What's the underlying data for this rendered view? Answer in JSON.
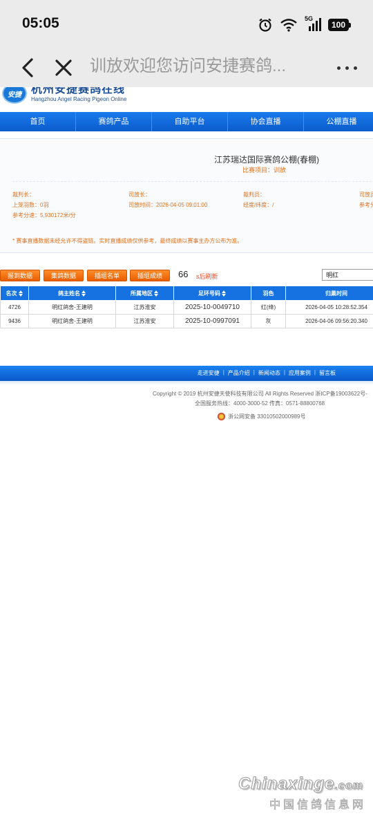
{
  "status_bar": {
    "time": "05:05",
    "network": "5G",
    "battery": "100",
    "icons": [
      "alarm-icon",
      "wifi-icon",
      "signal-icon",
      "battery-icon"
    ]
  },
  "browser": {
    "page_title": "训放欢迎您访问安捷赛鸽...",
    "icons": [
      "back-icon",
      "close-icon",
      "more-icon"
    ]
  },
  "site": {
    "logo_mark": "安捷",
    "logo_cn": "杭州安捷赛鸽在线",
    "logo_en": "Hangzhou Angel Racing Pigeon Online"
  },
  "nav": [
    "首页",
    "赛鸽产品",
    "自助平台",
    "协会直播",
    "公棚直播"
  ],
  "race": {
    "title": "江苏瑞达国际赛鸽公棚(春棚)",
    "subtitle": "比赛项目：训放",
    "fields": {
      "referee_chief_label": "裁判长：",
      "referee_chief_value": "",
      "release_chief_label": "司放长：",
      "release_chief_value": "",
      "referee_label": "裁判员：",
      "referee_value": "",
      "release_staff_label": "司放员",
      "on_coop_label": "上笼羽数：",
      "on_coop_value": "0羽",
      "release_time_label": "司放时间：",
      "release_time_value": "2026-04-05 09:01:00",
      "coords_label": "经度/纬度：",
      "coords_value": "/",
      "reference_cut_label": "参考分",
      "speed_label": "参考分速：",
      "speed_value": "5,930172米/分"
    },
    "notice": "* 赛事直播数据未经允许不得盗链。实时直播成绩仅供参考，最终成绩以赛事主办方公布为准。"
  },
  "toolbar": {
    "buttons": [
      "报到数据",
      "集鸽数据",
      "插组名单",
      "插组成绩"
    ],
    "countdown": "66",
    "countdown_suffix": "s后刷新",
    "search_value": "明红"
  },
  "table": {
    "headers": [
      "名次",
      "鸽主姓名",
      "所属地区",
      "足环号码",
      "羽色",
      "归巢时间"
    ],
    "rows": [
      [
        "4726",
        "明红鸽舍-王建明",
        "江苏淮安",
        "2025-10-0049710",
        "红(绛)",
        "2026-04-05 10:28:52.354"
      ],
      [
        "9436",
        "明红鸽舍-王建明",
        "江苏淮安",
        "2025-10-0997091",
        "灰",
        "2026-04-06 09:56:20.340"
      ]
    ]
  },
  "footer": {
    "links": [
      "走进安捷",
      "产品介绍",
      "新闻动态",
      "应用案例",
      "留言板"
    ],
    "copyright": "Copyright © 2019 杭州安捷天使科技有限公司 All Rights Reserved 浙ICP备19003622号-",
    "hotline": "全国服务热线：4000-3000-52 传真：0571-88800768",
    "police": "浙公网安备 33010502000989号"
  },
  "watermark": {
    "en_main": "Chinaxinge",
    "en_suffix": ".com",
    "cn": "中国信鸽信息网"
  },
  "colors": {
    "nav_blue": "#0d63d6",
    "header_blue": "#1572e0",
    "accent_orange": "#e0701c",
    "button_orange": "#ff8c2a"
  }
}
